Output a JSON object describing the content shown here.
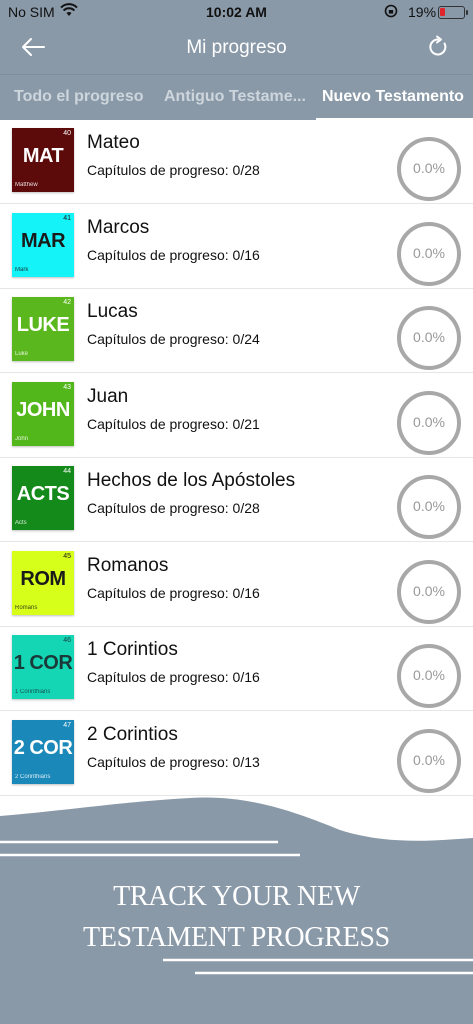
{
  "status_bar": {
    "carrier": "No SIM",
    "time": "10:02 AM",
    "battery": "19%",
    "battery_color": "#e0262a"
  },
  "nav": {
    "title": "Mi progreso",
    "back_icon": "arrow-left-icon",
    "refresh_icon": "refresh-icon"
  },
  "tabs": [
    {
      "label": "Todo el progreso",
      "active": false
    },
    {
      "label": "Antiguo Testame...",
      "active": false
    },
    {
      "label": "Nuevo Testamento",
      "active": true
    }
  ],
  "books": [
    {
      "name": "Mateo",
      "progress": "Capítulos de progreso: 0/28",
      "percent": "0.0%",
      "abbr": "MAT",
      "num": "40",
      "en": "Matthew",
      "color": "#5c0a0a",
      "text_color": "#ffffff"
    },
    {
      "name": "Marcos",
      "progress": "Capítulos de progreso: 0/16",
      "percent": "0.0%",
      "abbr": "MAR",
      "num": "41",
      "en": "Mark",
      "color": "#13f3f8",
      "text_color": "#1a1a1a"
    },
    {
      "name": "Lucas",
      "progress": "Capítulos de progreso: 0/24",
      "percent": "0.0%",
      "abbr": "LUKE",
      "num": "42",
      "en": "Luke",
      "color": "#5ab81e",
      "text_color": "#ffffff"
    },
    {
      "name": "Juan",
      "progress": "Capítulos de progreso: 0/21",
      "percent": "0.0%",
      "abbr": "JOHN",
      "num": "43",
      "en": "John",
      "color": "#52b71a",
      "text_color": "#ffffff"
    },
    {
      "name": "Hechos de los Apóstoles",
      "progress": "Capítulos de progreso: 0/28",
      "percent": "0.0%",
      "abbr": "ACTS",
      "num": "44",
      "en": "Acts",
      "color": "#148a1a",
      "text_color": "#ffffff"
    },
    {
      "name": "Romanos",
      "progress": "Capítulos de progreso: 0/16",
      "percent": "0.0%",
      "abbr": "ROM",
      "num": "45",
      "en": "Romans",
      "color": "#d6ff1a",
      "text_color": "#1a1a1a"
    },
    {
      "name": "1 Corintios",
      "progress": "Capítulos de progreso: 0/16",
      "percent": "0.0%",
      "abbr": "1 COR",
      "num": "46",
      "en": "1 Corinthians",
      "color": "#14d6b5",
      "text_color": "#1a3a3a"
    },
    {
      "name": "2 Corintios",
      "progress": "Capítulos de progreso: 0/13",
      "percent": "0.0%",
      "abbr": "2 COR",
      "num": "47",
      "en": "2 Corinthians",
      "color": "#1a88b8",
      "text_color": "#ffffff"
    }
  ],
  "promo": {
    "line1": "TRACK YOUR NEW",
    "line2": "TESTAMENT PROGRESS",
    "color": "#8a99a8"
  }
}
